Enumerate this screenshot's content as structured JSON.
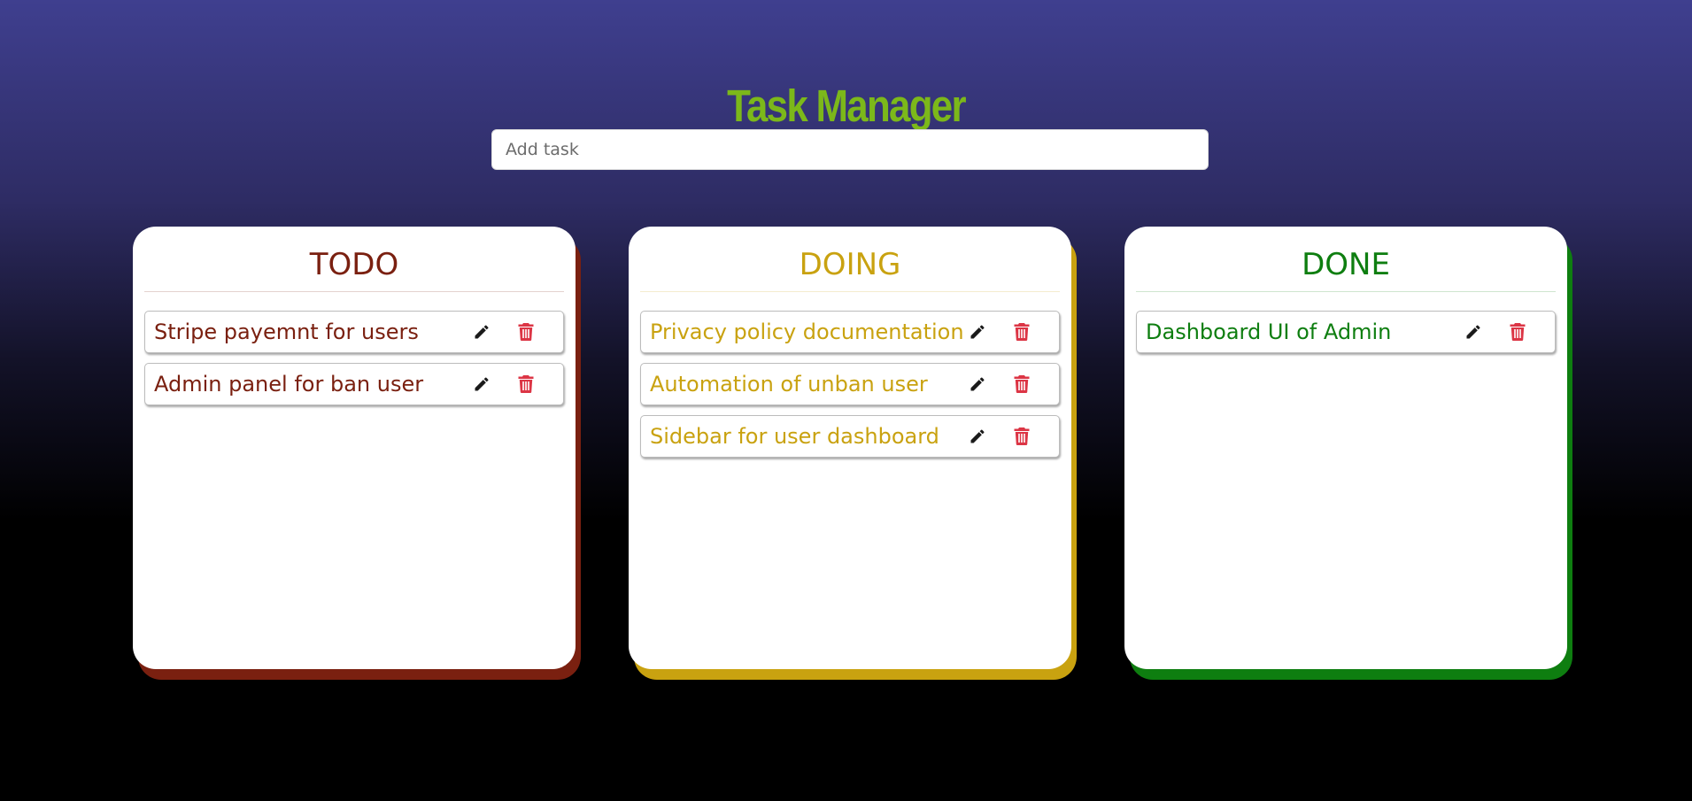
{
  "app": {
    "title": "Task Manager"
  },
  "add_task": {
    "placeholder": "Add task",
    "value": ""
  },
  "colors": {
    "title": "#7cb81a",
    "todo": "#7a2010",
    "doing": "#c9a210",
    "done": "#0e7e10",
    "edit_icon": "#1a1a1a",
    "delete_icon": "#dc3545"
  },
  "icons": {
    "edit": "pencil-icon",
    "delete": "trash-icon"
  },
  "columns": [
    {
      "id": "todo",
      "title": "TODO",
      "tasks": [
        "Stripe payemnt for users",
        "Admin panel for ban user"
      ]
    },
    {
      "id": "doing",
      "title": "DOING",
      "tasks": [
        "Privacy policy documentation",
        "Automation of unban user",
        "Sidebar for user dashboard"
      ]
    },
    {
      "id": "done",
      "title": "DONE",
      "tasks": [
        "Dashboard UI of Admin"
      ]
    }
  ]
}
